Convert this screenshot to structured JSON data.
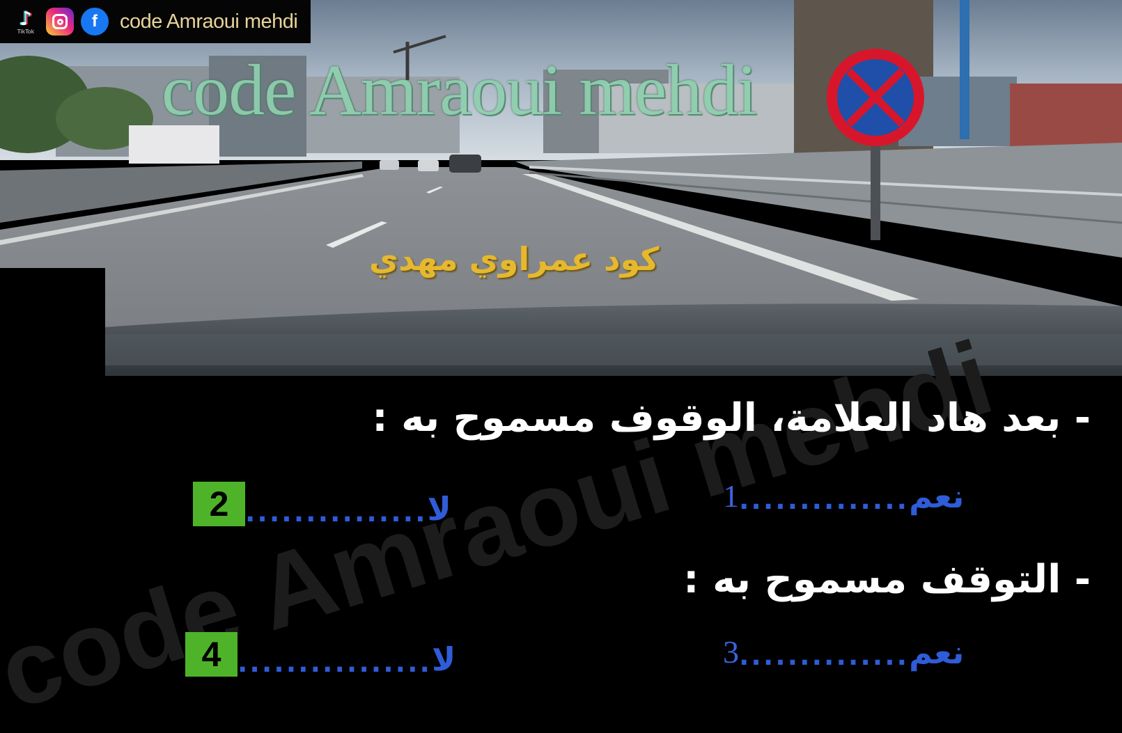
{
  "social": {
    "tiktok_label": "TikTok",
    "handle": "code Amraoui mehdi"
  },
  "watermark": {
    "latin": "code Amraoui mehdi",
    "arabic": "كود عمراوي مهدي"
  },
  "questions": [
    {
      "text": "- بعد هاد العلامة، الوقوف مسموح به :",
      "options": [
        {
          "label": "نعم",
          "dots": "..............",
          "number": "1"
        },
        {
          "label": "لا",
          "dots": "...............",
          "number": "2"
        }
      ]
    },
    {
      "text": "- التوقف مسموح به :",
      "options": [
        {
          "label": "نعم",
          "dots": "..............",
          "number": "3"
        },
        {
          "label": "لا",
          "dots": "................",
          "number": "4"
        }
      ]
    }
  ],
  "colors": {
    "answer_text": "#2f5cd8",
    "badge_green": "#4fb32a",
    "sign_red": "#d8162b",
    "sign_blue": "#1f4fa8"
  },
  "icons": [
    "tiktok-icon",
    "instagram-icon",
    "facebook-icon"
  ]
}
